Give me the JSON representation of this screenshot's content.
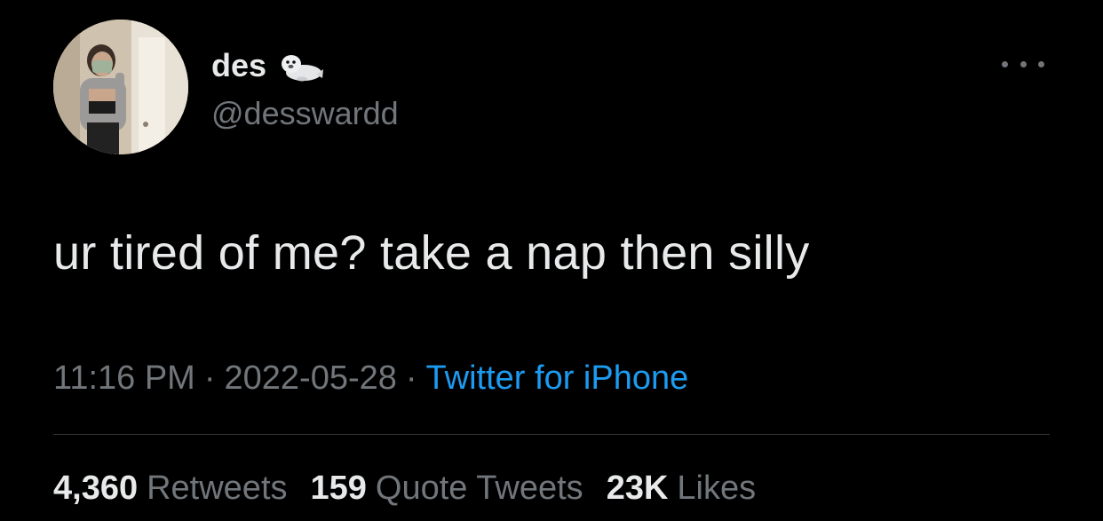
{
  "tweet": {
    "author": {
      "display_name": "des",
      "name_emoji": "seal-emoji",
      "handle": "@desswardd",
      "avatar": "profile-photo"
    },
    "more_icon": "more-horizontal-icon",
    "text": "ur tired of me? take a nap then silly",
    "meta": {
      "time": "11:16 PM",
      "separator": "·",
      "date": "2022-05-28",
      "source": "Twitter for iPhone"
    },
    "stats": {
      "retweets_count": "4,360",
      "retweets_label": "Retweets",
      "quotes_count": "159",
      "quotes_label": "Quote Tweets",
      "likes_count": "23K",
      "likes_label": "Likes"
    }
  },
  "colors": {
    "background": "#000000",
    "primary_text": "#e7e9ea",
    "secondary_text": "#71767b",
    "link": "#1d9bf0",
    "divider": "#2f3336"
  }
}
